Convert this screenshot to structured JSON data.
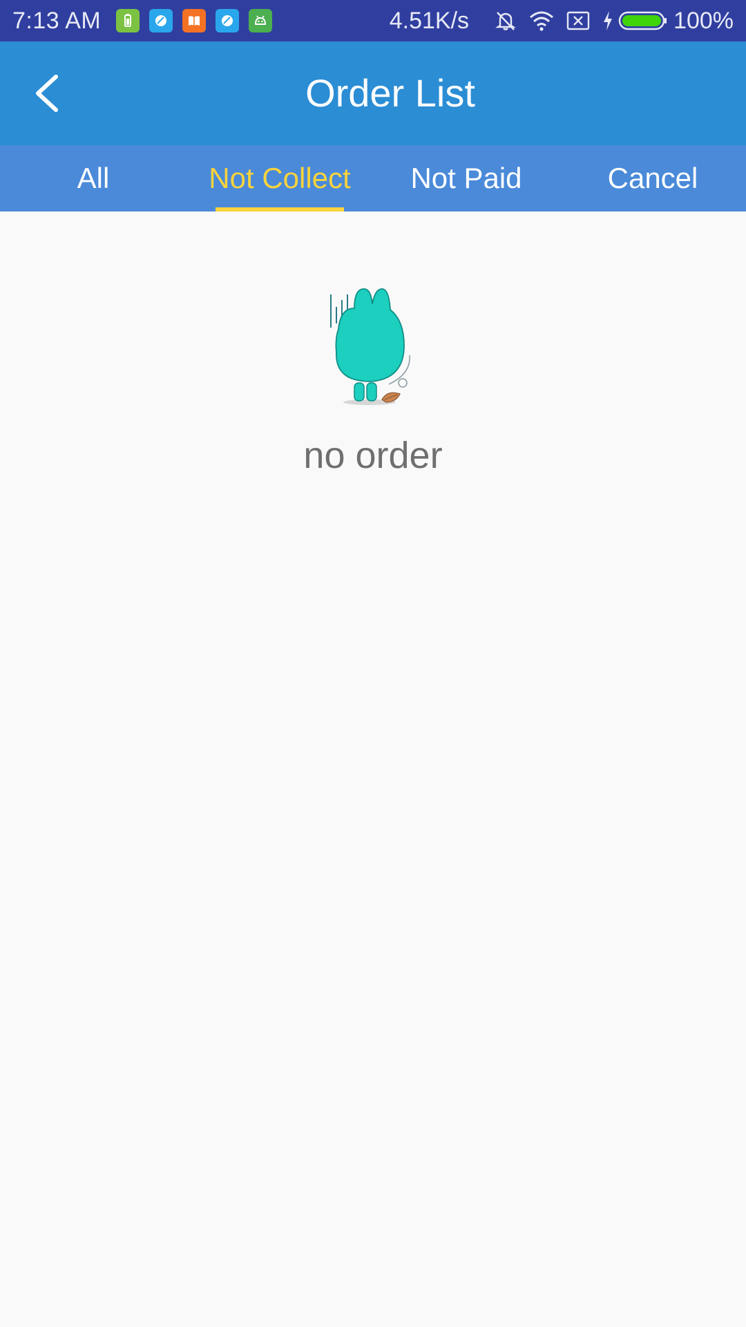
{
  "status_bar": {
    "time": "7:13  AM",
    "net_speed": "4.51K/s",
    "battery": "100%",
    "app_icons": [
      {
        "name": "battery-app-icon",
        "color": "#7cc242"
      },
      {
        "name": "browser-app-icon",
        "color": "#2aa7ec"
      },
      {
        "name": "book-app-icon",
        "color": "#f57224"
      },
      {
        "name": "browser-app-icon-2",
        "color": "#2aa7ec"
      },
      {
        "name": "android-app-icon",
        "color": "#4caf50"
      }
    ]
  },
  "header": {
    "title": "Order List",
    "back_icon": "chevron-left-icon"
  },
  "tabs": [
    {
      "label": "All",
      "active": false
    },
    {
      "label": "Not Collect",
      "active": true
    },
    {
      "label": "Not Paid",
      "active": false
    },
    {
      "label": "Cancel",
      "active": false
    }
  ],
  "empty_state": {
    "message": "no order",
    "illustration": "mascot-icon"
  },
  "colors": {
    "status_bar": "#303F9F",
    "header": "#2b8dd4",
    "tab_bar": "#4a8ad9",
    "active_tab": "#f9d33c",
    "background": "#f9f9f9",
    "mascot": "#1ccfbf"
  }
}
